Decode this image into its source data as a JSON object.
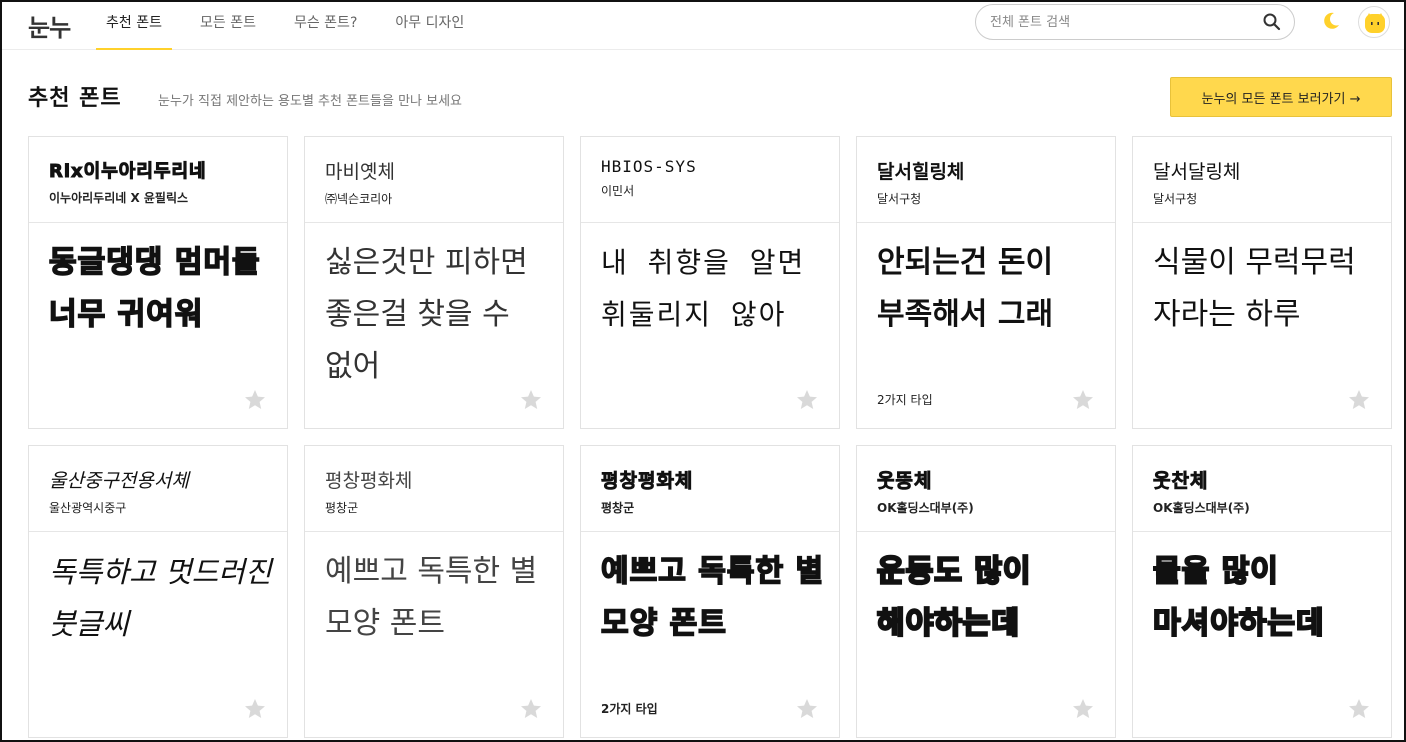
{
  "header": {
    "logo": "눈누",
    "nav": [
      "추천 폰트",
      "모든 폰트",
      "무슨 폰트?",
      "아무 디자인"
    ],
    "search_placeholder": "전체 폰트 검색",
    "accent_color": "#ffd12b"
  },
  "page": {
    "title": "추천 폰트",
    "subtitle": "눈누가 직접 제안하는 용도별 추천 폰트들을 만나 보세요",
    "all_fonts_button": "눈누의 모든 폰트 보러가기 →"
  },
  "cards": [
    {
      "name": "Rix이누아리두리네",
      "maker": "이누아리두리네 X 윤필릭스",
      "sample": "동글댕댕 멈머들 너무 귀여워",
      "types": "",
      "style": "heavy"
    },
    {
      "name": "마비옛체",
      "maker": "㈜넥슨코리아",
      "sample": "싫은것만 피하면 좋은걸 찾을 수 없어",
      "types": "",
      "style": "light"
    },
    {
      "name": "HBIOS-SYS",
      "maker": "이민서",
      "sample": "내 취향을 알면 휘둘리지 않아",
      "types": "",
      "style": "mono"
    },
    {
      "name": "달서힐링체",
      "maker": "달서구청",
      "sample": "안되는건 돈이 부족해서 그래",
      "types": "2가지 타입",
      "style": "bold"
    },
    {
      "name": "달서달링체",
      "maker": "달서구청",
      "sample": "식물이 무럭무럭 자라는 하루",
      "types": "",
      "style": "light"
    },
    {
      "name": "울산중구전용서체",
      "maker": "울산광역시중구",
      "sample": "독특하고 멋드러진 붓글씨",
      "types": "",
      "style": "serif"
    },
    {
      "name": "평창평화체",
      "maker": "평창군",
      "sample": "예쁘고 독특한 별 모양 폰트",
      "types": "",
      "style": "light"
    },
    {
      "name": "평창평화체",
      "maker": "평창군",
      "sample": "예쁘고 독특한 별 모양 폰트",
      "types": "2가지 타입",
      "style": "heavy"
    },
    {
      "name": "웃뜽체",
      "maker": "OK홀딩스대부(주)",
      "sample": "운동도 많이 해야하는데",
      "types": "",
      "style": "heavy"
    },
    {
      "name": "웃찬체",
      "maker": "OK홀딩스대부(주)",
      "sample": "물을 많이 마셔야하는데",
      "types": "",
      "style": "heavy"
    }
  ]
}
